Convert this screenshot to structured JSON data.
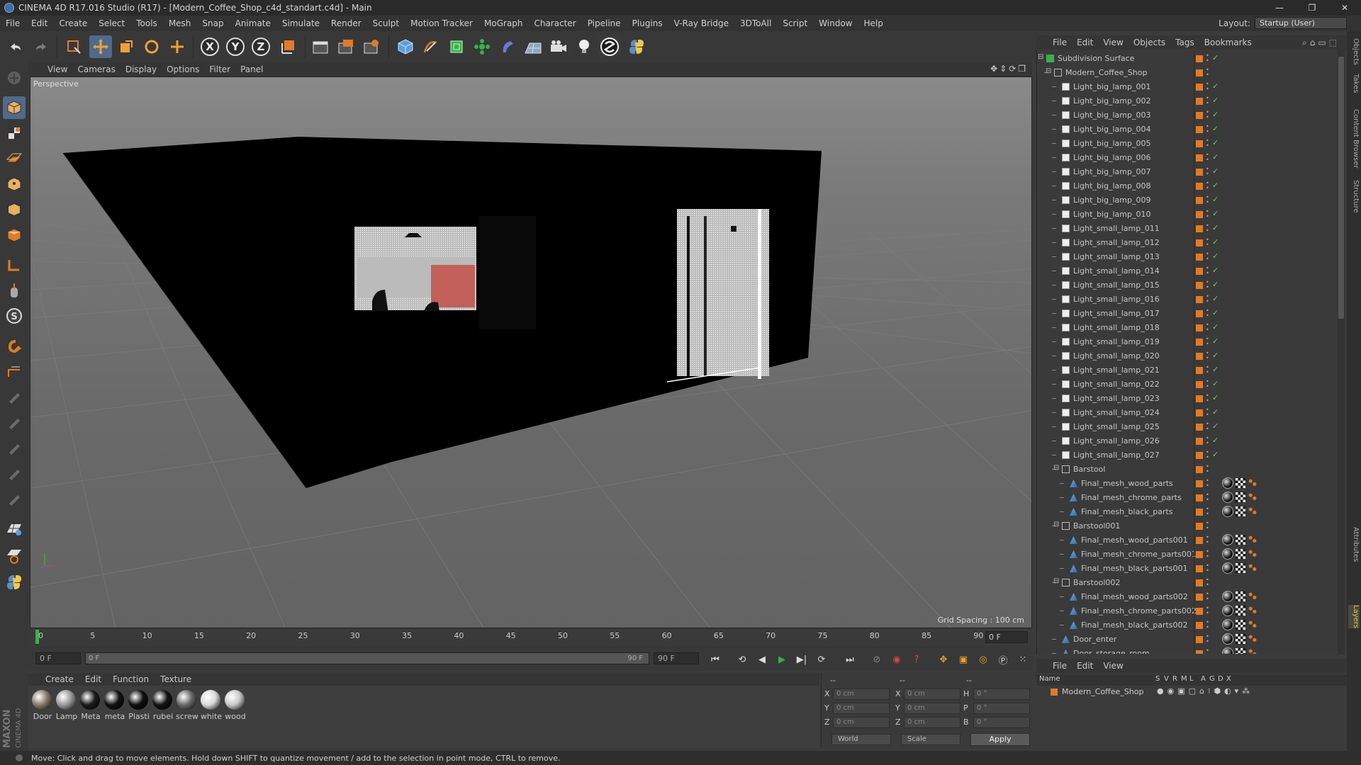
{
  "window": {
    "title": "CINEMA 4D R17.016 Studio (R17) - [Modern_Coffee_Shop_c4d_standart.c4d] - Main",
    "minimize": "—",
    "maximize": "❐",
    "close": "✕"
  },
  "menubar": {
    "items": [
      "File",
      "Edit",
      "Create",
      "Select",
      "Tools",
      "Mesh",
      "Snap",
      "Animate",
      "Simulate",
      "Render",
      "Sculpt",
      "Motion Tracker",
      "MoGraph",
      "Character",
      "Pipeline",
      "Plugins",
      "V-Ray Bridge",
      "3DToAll",
      "Script",
      "Window",
      "Help"
    ],
    "layout_label": "Layout:",
    "layout_value": "Startup (User)"
  },
  "toolbar": {
    "axis_x": "X",
    "axis_y": "Y",
    "axis_z": "Z"
  },
  "viewport": {
    "menu": [
      "View",
      "Cameras",
      "Display",
      "Options",
      "Filter",
      "Panel"
    ],
    "name": "Perspective",
    "grid_spacing": "Grid Spacing : 100 cm"
  },
  "timeline": {
    "ticks": [
      "0",
      "5",
      "10",
      "15",
      "20",
      "25",
      "30",
      "35",
      "40",
      "45",
      "50",
      "55",
      "60",
      "65",
      "70",
      "75",
      "80",
      "85",
      "90"
    ],
    "current_frame": "0 F",
    "start_field": "0 F",
    "range_start": "0 F",
    "range_end": "90 F",
    "end_field": "90 F"
  },
  "materials": {
    "menu": [
      "Create",
      "Edit",
      "Function",
      "Texture"
    ],
    "items": [
      {
        "name": "Door",
        "color": "#8a7a6a"
      },
      {
        "name": "Lamp",
        "color": "#9a9a9a"
      },
      {
        "name": "Meta",
        "color": "#1a1a1a"
      },
      {
        "name": "meta",
        "color": "#111111"
      },
      {
        "name": "Plasti",
        "color": "#0e0e0e"
      },
      {
        "name": "rubei",
        "color": "#121212"
      },
      {
        "name": "screw",
        "color": "#6a6a6a"
      },
      {
        "name": "white",
        "color": "#d8d8d8"
      },
      {
        "name": "wood",
        "color": "#c8c8c8"
      }
    ]
  },
  "coordinates": {
    "header_a": "--",
    "header_b": "--",
    "header_c": "--",
    "x_label": "X",
    "y_label": "Y",
    "z_label": "Z",
    "x": "0 cm",
    "y": "0 cm",
    "z": "0 cm",
    "sx": "0 cm",
    "sy": "0 cm",
    "sz": "0 cm",
    "h_label": "H",
    "p_label": "P",
    "b_label": "B",
    "h": "0 °",
    "p": "0 °",
    "b": "0 °",
    "space": "World",
    "mode": "Scale",
    "apply": "Apply"
  },
  "status": {
    "text": "Move: Click and drag to move elements. Hold down SHIFT to quantize movement / add to the selection in point mode, CTRL to remove."
  },
  "objects": {
    "menu": [
      "File",
      "Edit",
      "View",
      "Objects",
      "Tags",
      "Bookmarks"
    ],
    "rows": [
      {
        "name": "Subdivision Surface",
        "indent": 0,
        "type": "subd",
        "check": true,
        "tags": false
      },
      {
        "name": "Modern_Coffee_Shop",
        "indent": 1,
        "type": "null",
        "check": false,
        "tags": false
      },
      {
        "name": "Light_big_lamp_001",
        "indent": 2,
        "type": "light",
        "check": true,
        "tags": false
      },
      {
        "name": "Light_big_lamp_002",
        "indent": 2,
        "type": "light",
        "check": true,
        "tags": false
      },
      {
        "name": "Light_big_lamp_003",
        "indent": 2,
        "type": "light",
        "check": true,
        "tags": false
      },
      {
        "name": "Light_big_lamp_004",
        "indent": 2,
        "type": "light",
        "check": true,
        "tags": false
      },
      {
        "name": "Light_big_lamp_005",
        "indent": 2,
        "type": "light",
        "check": true,
        "tags": false
      },
      {
        "name": "Light_big_lamp_006",
        "indent": 2,
        "type": "light",
        "check": true,
        "tags": false
      },
      {
        "name": "Light_big_lamp_007",
        "indent": 2,
        "type": "light",
        "check": true,
        "tags": false
      },
      {
        "name": "Light_big_lamp_008",
        "indent": 2,
        "type": "light",
        "check": true,
        "tags": false
      },
      {
        "name": "Light_big_lamp_009",
        "indent": 2,
        "type": "light",
        "check": true,
        "tags": false
      },
      {
        "name": "Light_big_lamp_010",
        "indent": 2,
        "type": "light",
        "check": true,
        "tags": false
      },
      {
        "name": "Light_small_lamp_011",
        "indent": 2,
        "type": "light",
        "check": true,
        "tags": false
      },
      {
        "name": "Light_small_lamp_012",
        "indent": 2,
        "type": "light",
        "check": true,
        "tags": false
      },
      {
        "name": "Light_small_lamp_013",
        "indent": 2,
        "type": "light",
        "check": true,
        "tags": false
      },
      {
        "name": "Light_small_lamp_014",
        "indent": 2,
        "type": "light",
        "check": true,
        "tags": false
      },
      {
        "name": "Light_small_lamp_015",
        "indent": 2,
        "type": "light",
        "check": true,
        "tags": false
      },
      {
        "name": "Light_small_lamp_016",
        "indent": 2,
        "type": "light",
        "check": true,
        "tags": false
      },
      {
        "name": "Light_small_lamp_017",
        "indent": 2,
        "type": "light",
        "check": true,
        "tags": false
      },
      {
        "name": "Light_small_lamp_018",
        "indent": 2,
        "type": "light",
        "check": true,
        "tags": false
      },
      {
        "name": "Light_small_lamp_019",
        "indent": 2,
        "type": "light",
        "check": true,
        "tags": false
      },
      {
        "name": "Light_small_lamp_020",
        "indent": 2,
        "type": "light",
        "check": true,
        "tags": false
      },
      {
        "name": "Light_small_lamp_021",
        "indent": 2,
        "type": "light",
        "check": true,
        "tags": false
      },
      {
        "name": "Light_small_lamp_022",
        "indent": 2,
        "type": "light",
        "check": true,
        "tags": false
      },
      {
        "name": "Light_small_lamp_023",
        "indent": 2,
        "type": "light",
        "check": true,
        "tags": false
      },
      {
        "name": "Light_small_lamp_024",
        "indent": 2,
        "type": "light",
        "check": true,
        "tags": false
      },
      {
        "name": "Light_small_lamp_025",
        "indent": 2,
        "type": "light",
        "check": true,
        "tags": false
      },
      {
        "name": "Light_small_lamp_026",
        "indent": 2,
        "type": "light",
        "check": true,
        "tags": false
      },
      {
        "name": "Light_small_lamp_027",
        "indent": 2,
        "type": "light",
        "check": true,
        "tags": false
      },
      {
        "name": "Barstool",
        "indent": 2,
        "type": "null",
        "check": false,
        "tags": false
      },
      {
        "name": "Final_mesh_wood_parts",
        "indent": 3,
        "type": "mesh",
        "check": false,
        "tags": true
      },
      {
        "name": "Final_mesh_chrome_parts",
        "indent": 3,
        "type": "mesh",
        "check": false,
        "tags": true
      },
      {
        "name": "Final_mesh_black_parts",
        "indent": 3,
        "type": "mesh",
        "check": false,
        "tags": true
      },
      {
        "name": "Barstool001",
        "indent": 2,
        "type": "null",
        "check": false,
        "tags": false
      },
      {
        "name": "Final_mesh_wood_parts001",
        "indent": 3,
        "type": "mesh",
        "check": false,
        "tags": true
      },
      {
        "name": "Final_mesh_chrome_parts001",
        "indent": 3,
        "type": "mesh",
        "check": false,
        "tags": true
      },
      {
        "name": "Final_mesh_black_parts001",
        "indent": 3,
        "type": "mesh",
        "check": false,
        "tags": true
      },
      {
        "name": "Barstool002",
        "indent": 2,
        "type": "null",
        "check": false,
        "tags": false
      },
      {
        "name": "Final_mesh_wood_parts002",
        "indent": 3,
        "type": "mesh",
        "check": false,
        "tags": true
      },
      {
        "name": "Final_mesh_chrome_parts002",
        "indent": 3,
        "type": "mesh",
        "check": false,
        "tags": true
      },
      {
        "name": "Final_mesh_black_parts002",
        "indent": 3,
        "type": "mesh",
        "check": false,
        "tags": true
      },
      {
        "name": "Door_enter",
        "indent": 2,
        "type": "mesh",
        "check": false,
        "tags": true
      },
      {
        "name": "Door_storage_room",
        "indent": 2,
        "type": "mesh",
        "check": false,
        "tags": true
      }
    ]
  },
  "layers": {
    "menu": [
      "File",
      "Edit",
      "View"
    ],
    "columns": [
      "Name",
      "S",
      "V",
      "R",
      "M",
      "L",
      "A",
      "G",
      "D",
      "X"
    ],
    "row_name": "Modern_Coffee_Shop",
    "row_color": "#e07b27"
  },
  "side_tabs": [
    "Objects",
    "Takes",
    "Content Browser",
    "Structure",
    "Attributes",
    "Layers"
  ],
  "colors": {
    "accent_orange": "#e07b27",
    "check_green": "#6fcf4a",
    "selected_blue": "#4e6a8c"
  }
}
